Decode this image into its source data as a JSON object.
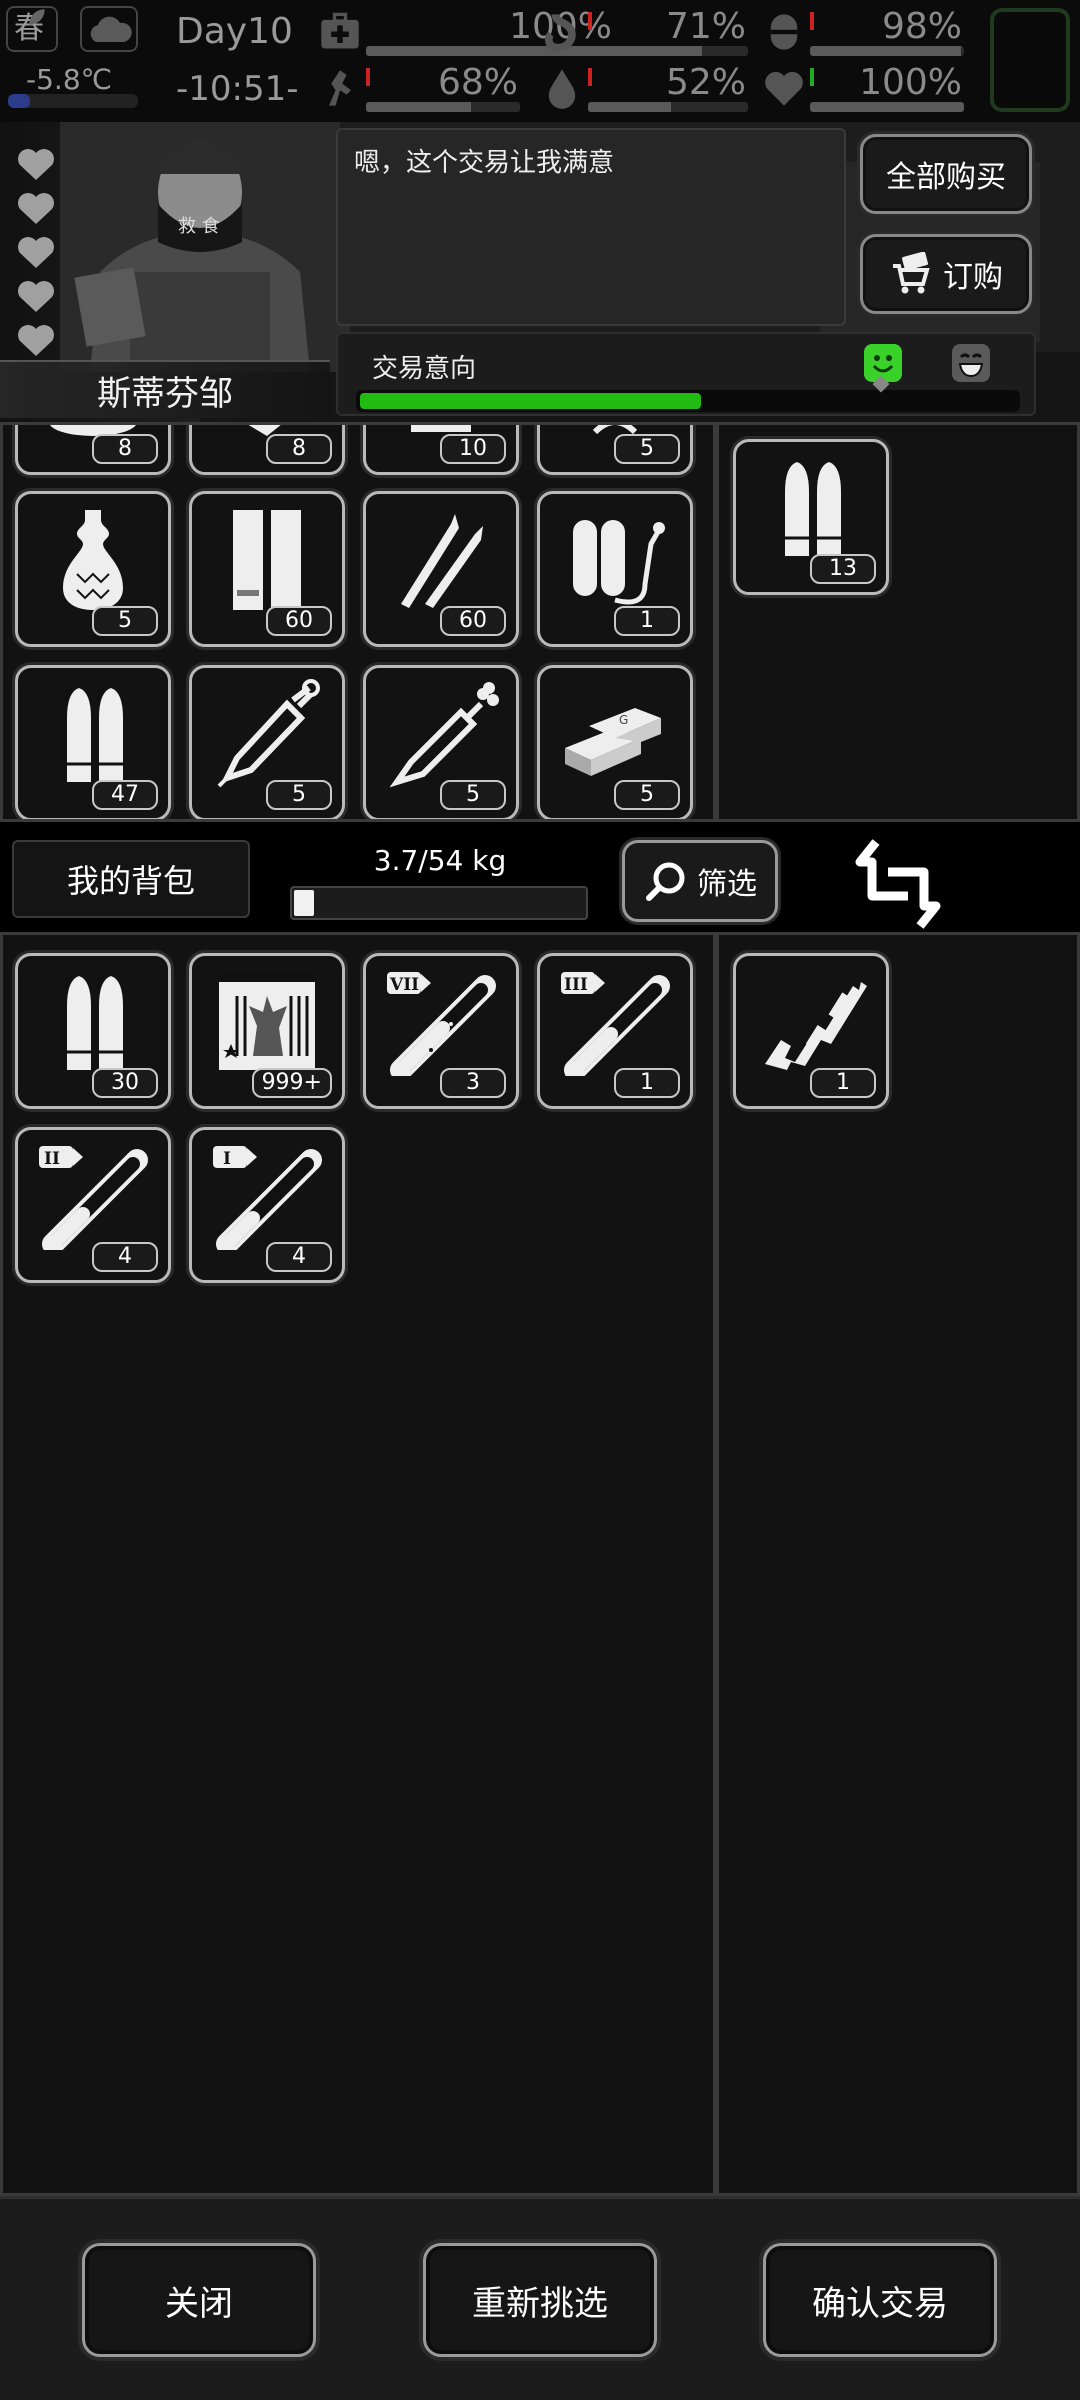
{
  "status_bar": {
    "season": "春",
    "temperature": "-5.8℃",
    "day": "Day10",
    "time": "-10:51-",
    "stats": [
      {
        "icon": "medkit-icon",
        "value": "100%",
        "fraction": 1.0
      },
      {
        "icon": "stomach-icon",
        "value": "71%",
        "fraction": 0.71
      },
      {
        "icon": "bladder-icon",
        "value": "98%",
        "fraction": 0.98
      },
      {
        "icon": "stamina-icon",
        "value": "68%",
        "fraction": 0.68
      },
      {
        "icon": "water-drop-icon",
        "value": "52%",
        "fraction": 0.52
      },
      {
        "icon": "heart-icon",
        "value": "100%",
        "fraction": 1.0
      }
    ]
  },
  "trader": {
    "name": "斯蒂芬邹",
    "dialog": "嗯，这个交易让我满意",
    "hearts": 5,
    "buy_all_label": "全部购买",
    "order_label": "订购",
    "intent_label": "交易意向",
    "intent_level": 0.52
  },
  "trader_inventory": {
    "partial_row_counts": [
      "8",
      "8",
      "10",
      "5"
    ],
    "items": [
      {
        "icon": "vase-icon",
        "count": "5"
      },
      {
        "icon": "magazine-icon",
        "count": "60"
      },
      {
        "icon": "rifle-rounds-icon",
        "count": "60"
      },
      {
        "icon": "oxygen-tank-icon",
        "count": "1"
      },
      {
        "icon": "pistol-rounds-icon",
        "count": "47"
      },
      {
        "icon": "syringe-icon",
        "count": "5"
      },
      {
        "icon": "syringe-flower-icon",
        "count": "5"
      },
      {
        "icon": "gold-bars-icon",
        "count": "5"
      }
    ],
    "offer": [
      {
        "icon": "pistol-rounds-icon",
        "count": "13"
      }
    ]
  },
  "backpack": {
    "label": "我的背包",
    "weight": "3.7/54 kg",
    "weight_fraction": 0.069,
    "filter_label": "筛选",
    "items": [
      {
        "icon": "pistol-rounds-icon",
        "count": "30"
      },
      {
        "icon": "zombie-poster-icon",
        "count": "999+"
      },
      {
        "icon": "test-tube-icon",
        "tier": "VII",
        "count": "3"
      },
      {
        "icon": "test-tube-icon",
        "tier": "III",
        "count": "1"
      },
      {
        "icon": "test-tube-icon",
        "tier": "II",
        "count": "4"
      },
      {
        "icon": "test-tube-icon",
        "tier": "I",
        "count": "4"
      }
    ],
    "offer": [
      {
        "icon": "assault-rifle-icon",
        "count": "1"
      }
    ]
  },
  "footer": {
    "close_label": "关闭",
    "reselect_label": "重新挑选",
    "confirm_label": "确认交易"
  },
  "colors": {
    "intent_green": "#22bb11",
    "panel_bg": "#121212",
    "slot_border": "#b9b9b9"
  }
}
